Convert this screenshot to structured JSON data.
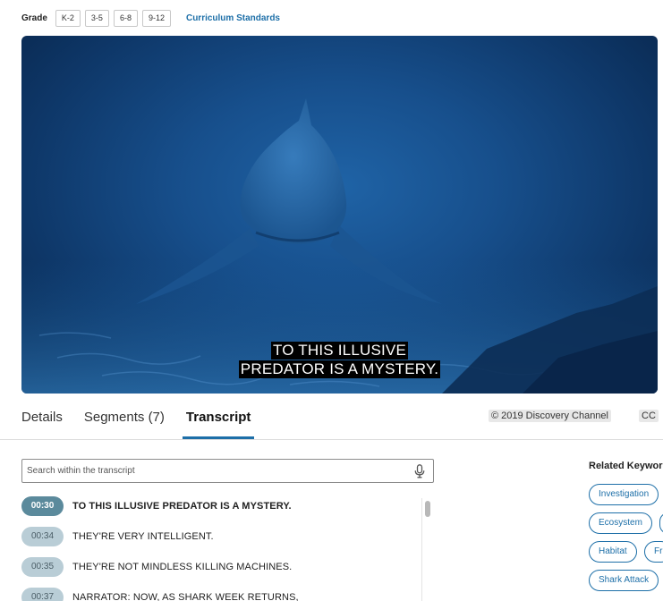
{
  "grade": {
    "label": "Grade",
    "levels": [
      "K-2",
      "3-5",
      "6-8",
      "9-12"
    ],
    "standards_link": "Curriculum Standards"
  },
  "video": {
    "caption_lines": [
      "TO THIS ILLUSIVE",
      "PREDATOR IS A MYSTERY."
    ]
  },
  "tabs": [
    "Details",
    "Segments (7)",
    "Transcript"
  ],
  "active_tab": "Transcript",
  "copyright": "© 2019 Discovery Channel",
  "cc_label": "CC",
  "search": {
    "placeholder": "Search within the transcript"
  },
  "transcript": [
    {
      "time": "00:30",
      "text": "TO THIS ILLUSIVE PREDATOR IS A MYSTERY.",
      "active": true
    },
    {
      "time": "00:34",
      "text": "THEY'RE VERY INTELLIGENT.",
      "active": false
    },
    {
      "time": "00:35",
      "text": "THEY'RE NOT MINDLESS KILLING MACHINES.",
      "active": false
    },
    {
      "time": "00:37",
      "text": "NARRATOR: NOW, AS SHARK WEEK RETURNS,",
      "active": false
    }
  ],
  "related": {
    "heading": "Related Keywords",
    "keywords": [
      "Investigation",
      "Ecosystem",
      "Habitat",
      "Fr",
      "Shark Attack"
    ]
  },
  "colors": {
    "accent": "#1d6fa8",
    "timestamp_active": "#5b8a9c",
    "timestamp": "#b9cdd6"
  }
}
